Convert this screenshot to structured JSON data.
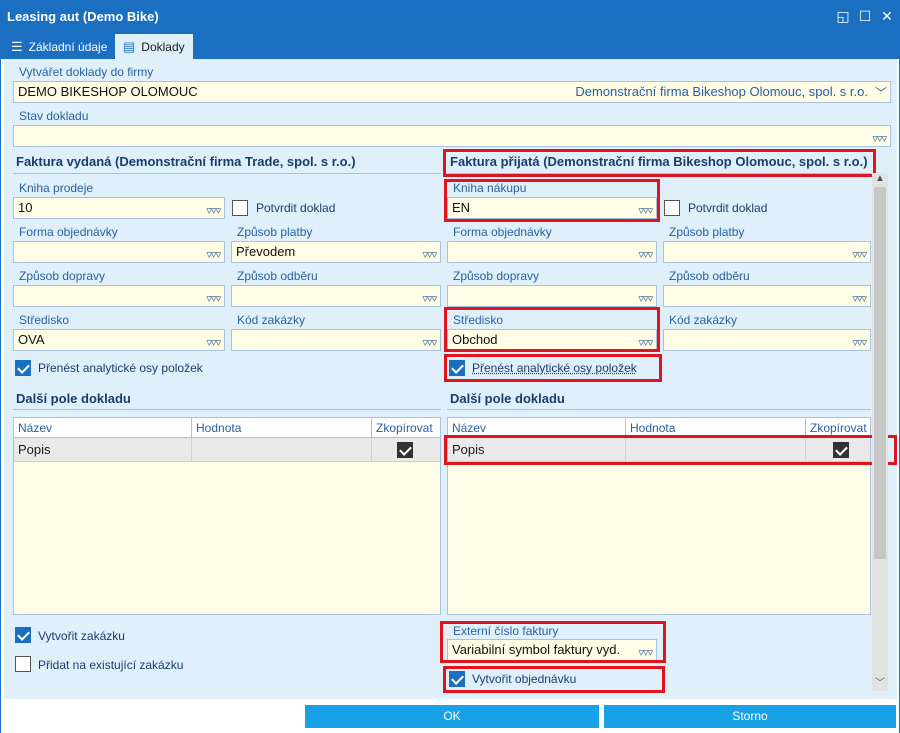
{
  "window": {
    "title": "Leasing aut (Demo Bike)"
  },
  "tabs": [
    {
      "label": "Základní údaje",
      "icon": "list-icon"
    },
    {
      "label": "Doklady",
      "icon": "document-icon"
    }
  ],
  "company": {
    "label": "Vytvářet doklady do firmy",
    "value": "DEMO BIKESHOP OLOMOUC",
    "description": "Demonstrační firma Bikeshop Olomouc, spol. s r.o."
  },
  "status": {
    "label": "Stav dokladu",
    "value": ""
  },
  "issued": {
    "header": "Faktura vydaná (Demonstrační firma Trade, spol. s r.o.)",
    "book_label": "Kniha prodeje",
    "book_value": "10",
    "confirm_label": "Potvrdit doklad",
    "order_form_label": "Forma objednávky",
    "order_form_value": "",
    "payment_label": "Způsob platby",
    "payment_value": "Převodem",
    "transport_label": "Způsob dopravy",
    "transport_value": "",
    "pickup_label": "Způsob odběru",
    "pickup_value": "",
    "center_label": "Středisko",
    "center_value": "OVA",
    "contract_label": "Kód zakázky",
    "contract_value": "",
    "transfer_label": "Přenést analytické osy položek",
    "other_header": "Další pole dokladu",
    "grid_cols": [
      "Název",
      "Hodnota",
      "Zkopírovat"
    ],
    "grid_row": {
      "name": "Popis",
      "value": ""
    },
    "create_contract_label": "Vytvořit zakázku",
    "add_existing_label": "Přidat na existující zakázku"
  },
  "received": {
    "header": "Faktura přijatá (Demonstrační firma Bikeshop Olomouc, spol. s r.o.)",
    "book_label": "Kniha nákupu",
    "book_value": "EN",
    "confirm_label": "Potvrdit doklad",
    "order_form_label": "Forma objednávky",
    "order_form_value": "",
    "payment_label": "Způsob platby",
    "payment_value": "",
    "transport_label": "Způsob dopravy",
    "transport_value": "",
    "pickup_label": "Způsob odběru",
    "pickup_value": "",
    "center_label": "Středisko",
    "center_value": "Obchod",
    "contract_label": "Kód zakázky",
    "contract_value": "",
    "transfer_label": "Přenést analytické osy položek",
    "other_header": "Další pole dokladu",
    "grid_cols": [
      "Název",
      "Hodnota",
      "Zkopírovat"
    ],
    "grid_row": {
      "name": "Popis",
      "value": ""
    },
    "ext_number_label": "Externí číslo faktury",
    "ext_number_value": "Variabilní symbol faktury vyd.",
    "create_order_label": "Vytvořit objednávku"
  },
  "footer": {
    "ok_label": "OK",
    "cancel_label": "Storno"
  },
  "colors": {
    "accent": "#1b6fc1",
    "highlight": "#e0141e",
    "button": "#19a1e6",
    "field_bg": "#fffde5"
  }
}
